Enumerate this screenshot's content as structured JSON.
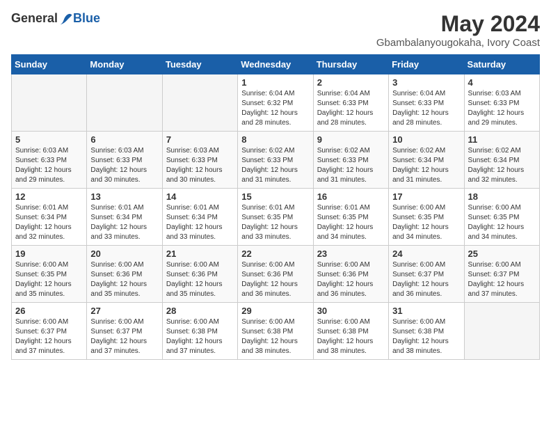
{
  "header": {
    "logo_general": "General",
    "logo_blue": "Blue",
    "month_year": "May 2024",
    "location": "Gbambalanyougokaha, Ivory Coast"
  },
  "days_of_week": [
    "Sunday",
    "Monday",
    "Tuesday",
    "Wednesday",
    "Thursday",
    "Friday",
    "Saturday"
  ],
  "weeks": [
    [
      {
        "day": "",
        "info": ""
      },
      {
        "day": "",
        "info": ""
      },
      {
        "day": "",
        "info": ""
      },
      {
        "day": "1",
        "info": "Sunrise: 6:04 AM\nSunset: 6:32 PM\nDaylight: 12 hours\nand 28 minutes."
      },
      {
        "day": "2",
        "info": "Sunrise: 6:04 AM\nSunset: 6:33 PM\nDaylight: 12 hours\nand 28 minutes."
      },
      {
        "day": "3",
        "info": "Sunrise: 6:04 AM\nSunset: 6:33 PM\nDaylight: 12 hours\nand 28 minutes."
      },
      {
        "day": "4",
        "info": "Sunrise: 6:03 AM\nSunset: 6:33 PM\nDaylight: 12 hours\nand 29 minutes."
      }
    ],
    [
      {
        "day": "5",
        "info": "Sunrise: 6:03 AM\nSunset: 6:33 PM\nDaylight: 12 hours\nand 29 minutes."
      },
      {
        "day": "6",
        "info": "Sunrise: 6:03 AM\nSunset: 6:33 PM\nDaylight: 12 hours\nand 30 minutes."
      },
      {
        "day": "7",
        "info": "Sunrise: 6:03 AM\nSunset: 6:33 PM\nDaylight: 12 hours\nand 30 minutes."
      },
      {
        "day": "8",
        "info": "Sunrise: 6:02 AM\nSunset: 6:33 PM\nDaylight: 12 hours\nand 31 minutes."
      },
      {
        "day": "9",
        "info": "Sunrise: 6:02 AM\nSunset: 6:33 PM\nDaylight: 12 hours\nand 31 minutes."
      },
      {
        "day": "10",
        "info": "Sunrise: 6:02 AM\nSunset: 6:34 PM\nDaylight: 12 hours\nand 31 minutes."
      },
      {
        "day": "11",
        "info": "Sunrise: 6:02 AM\nSunset: 6:34 PM\nDaylight: 12 hours\nand 32 minutes."
      }
    ],
    [
      {
        "day": "12",
        "info": "Sunrise: 6:01 AM\nSunset: 6:34 PM\nDaylight: 12 hours\nand 32 minutes."
      },
      {
        "day": "13",
        "info": "Sunrise: 6:01 AM\nSunset: 6:34 PM\nDaylight: 12 hours\nand 33 minutes."
      },
      {
        "day": "14",
        "info": "Sunrise: 6:01 AM\nSunset: 6:34 PM\nDaylight: 12 hours\nand 33 minutes."
      },
      {
        "day": "15",
        "info": "Sunrise: 6:01 AM\nSunset: 6:35 PM\nDaylight: 12 hours\nand 33 minutes."
      },
      {
        "day": "16",
        "info": "Sunrise: 6:01 AM\nSunset: 6:35 PM\nDaylight: 12 hours\nand 34 minutes."
      },
      {
        "day": "17",
        "info": "Sunrise: 6:00 AM\nSunset: 6:35 PM\nDaylight: 12 hours\nand 34 minutes."
      },
      {
        "day": "18",
        "info": "Sunrise: 6:00 AM\nSunset: 6:35 PM\nDaylight: 12 hours\nand 34 minutes."
      }
    ],
    [
      {
        "day": "19",
        "info": "Sunrise: 6:00 AM\nSunset: 6:35 PM\nDaylight: 12 hours\nand 35 minutes."
      },
      {
        "day": "20",
        "info": "Sunrise: 6:00 AM\nSunset: 6:36 PM\nDaylight: 12 hours\nand 35 minutes."
      },
      {
        "day": "21",
        "info": "Sunrise: 6:00 AM\nSunset: 6:36 PM\nDaylight: 12 hours\nand 35 minutes."
      },
      {
        "day": "22",
        "info": "Sunrise: 6:00 AM\nSunset: 6:36 PM\nDaylight: 12 hours\nand 36 minutes."
      },
      {
        "day": "23",
        "info": "Sunrise: 6:00 AM\nSunset: 6:36 PM\nDaylight: 12 hours\nand 36 minutes."
      },
      {
        "day": "24",
        "info": "Sunrise: 6:00 AM\nSunset: 6:37 PM\nDaylight: 12 hours\nand 36 minutes."
      },
      {
        "day": "25",
        "info": "Sunrise: 6:00 AM\nSunset: 6:37 PM\nDaylight: 12 hours\nand 37 minutes."
      }
    ],
    [
      {
        "day": "26",
        "info": "Sunrise: 6:00 AM\nSunset: 6:37 PM\nDaylight: 12 hours\nand 37 minutes."
      },
      {
        "day": "27",
        "info": "Sunrise: 6:00 AM\nSunset: 6:37 PM\nDaylight: 12 hours\nand 37 minutes."
      },
      {
        "day": "28",
        "info": "Sunrise: 6:00 AM\nSunset: 6:38 PM\nDaylight: 12 hours\nand 37 minutes."
      },
      {
        "day": "29",
        "info": "Sunrise: 6:00 AM\nSunset: 6:38 PM\nDaylight: 12 hours\nand 38 minutes."
      },
      {
        "day": "30",
        "info": "Sunrise: 6:00 AM\nSunset: 6:38 PM\nDaylight: 12 hours\nand 38 minutes."
      },
      {
        "day": "31",
        "info": "Sunrise: 6:00 AM\nSunset: 6:38 PM\nDaylight: 12 hours\nand 38 minutes."
      },
      {
        "day": "",
        "info": ""
      }
    ]
  ]
}
